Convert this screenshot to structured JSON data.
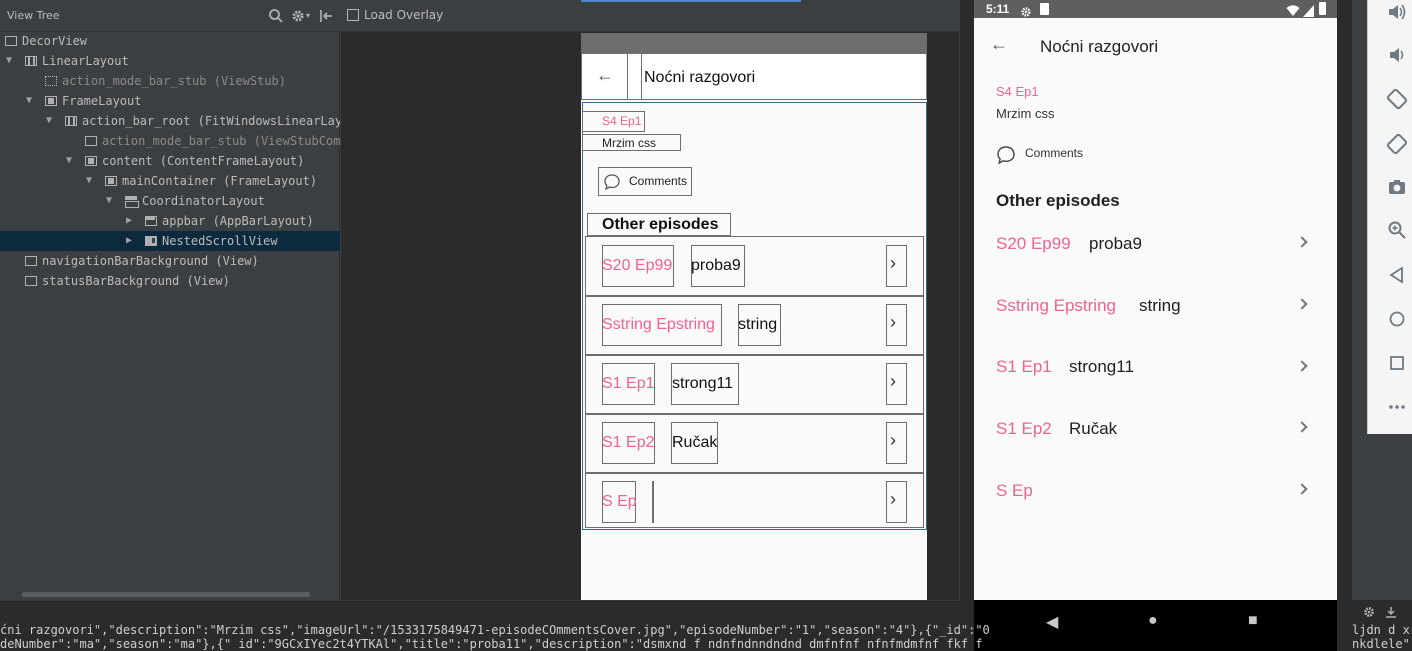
{
  "tree_panel": {
    "title": "View Tree",
    "nodes": [
      {
        "label": "DecorView"
      },
      {
        "label": "LinearLayout"
      },
      {
        "label": "action_mode_bar_stub (ViewStub)"
      },
      {
        "label": "FrameLayout"
      },
      {
        "label": "action_bar_root (FitWindowsLinearLayout)"
      },
      {
        "label": "action_mode_bar_stub (ViewStubCompat)"
      },
      {
        "label": "content (ContentFrameLayout)"
      },
      {
        "label": "mainContainer (FrameLayout)"
      },
      {
        "label": "CoordinatorLayout"
      },
      {
        "label": "appbar (AppBarLayout)"
      },
      {
        "label": "NestedScrollView"
      },
      {
        "label": "navigationBarBackground (View)"
      },
      {
        "label": "statusBarBackground (View)"
      }
    ],
    "expand_glyphs": {
      "open": "▼",
      "closed": "▶"
    }
  },
  "center_panel": {
    "overlay_label": "Load Overlay",
    "preview": {
      "back_glyph": "←",
      "title": "Noćni razgovori",
      "episode_label": "S4 Ep1",
      "description": "Mrzim css",
      "comments_label": "Comments",
      "other_episodes": "Other episodes",
      "episodes": [
        {
          "code": "S20 Ep99",
          "title": "proba9"
        },
        {
          "code": "Sstring Epstring",
          "title": "string"
        },
        {
          "code": "S1 Ep1",
          "title": "strong11"
        },
        {
          "code": "S1 Ep2",
          "title": "Ručak"
        },
        {
          "code": "S Ep",
          "title": ""
        }
      ],
      "chevron": "›"
    }
  },
  "phone": {
    "time": "5:11",
    "status_icons": [
      "gear-icon",
      "sd-card-icon",
      "wifi-icon",
      "signal-icon",
      "battery-icon"
    ],
    "back_glyph": "←",
    "title": "Noćni razgovori",
    "episode_label": "S4 Ep1",
    "description": "Mrzim css",
    "comments_label": "Comments",
    "other_episodes": "Other episodes",
    "episodes": [
      {
        "code": "S20 Ep99",
        "title": "proba9"
      },
      {
        "code": "Sstring Epstring",
        "title": "string"
      },
      {
        "code": "S1 Ep1",
        "title": "strong11"
      },
      {
        "code": "S1 Ep2",
        "title": "Ručak"
      },
      {
        "code": "S Ep",
        "title": ""
      }
    ],
    "nav": {
      "back": "◀",
      "home": "●",
      "recents": "■"
    }
  },
  "console": {
    "line1": "ćni razgovori\",\"description\":\"Mrzim css\",\"imageUrl\":\"/1533175849471-episodeCOmmentsCover.jpg\",\"episodeNumber\":\"1\",\"season\":\"4\"},{\"_id\":\"0",
    "line2": "deNumber\":\"ma\",\"season\":\"ma\"},{\" id\":\"9GCxIYec2t4YTKAl\",\"title\":\"proba11\",\"description\":\"dsmxnd f ndnfndnndndnd dmfnfnf nfnfmdmfnf fkf f",
    "right_line1": "ljdn d xr",
    "right_line2": "nkdlele\""
  },
  "colors": {
    "accent_pink": "#f06292",
    "ide_bg": "#3c3f41",
    "selection": "#0d293e",
    "layout_blue": "#2e6f8e"
  }
}
